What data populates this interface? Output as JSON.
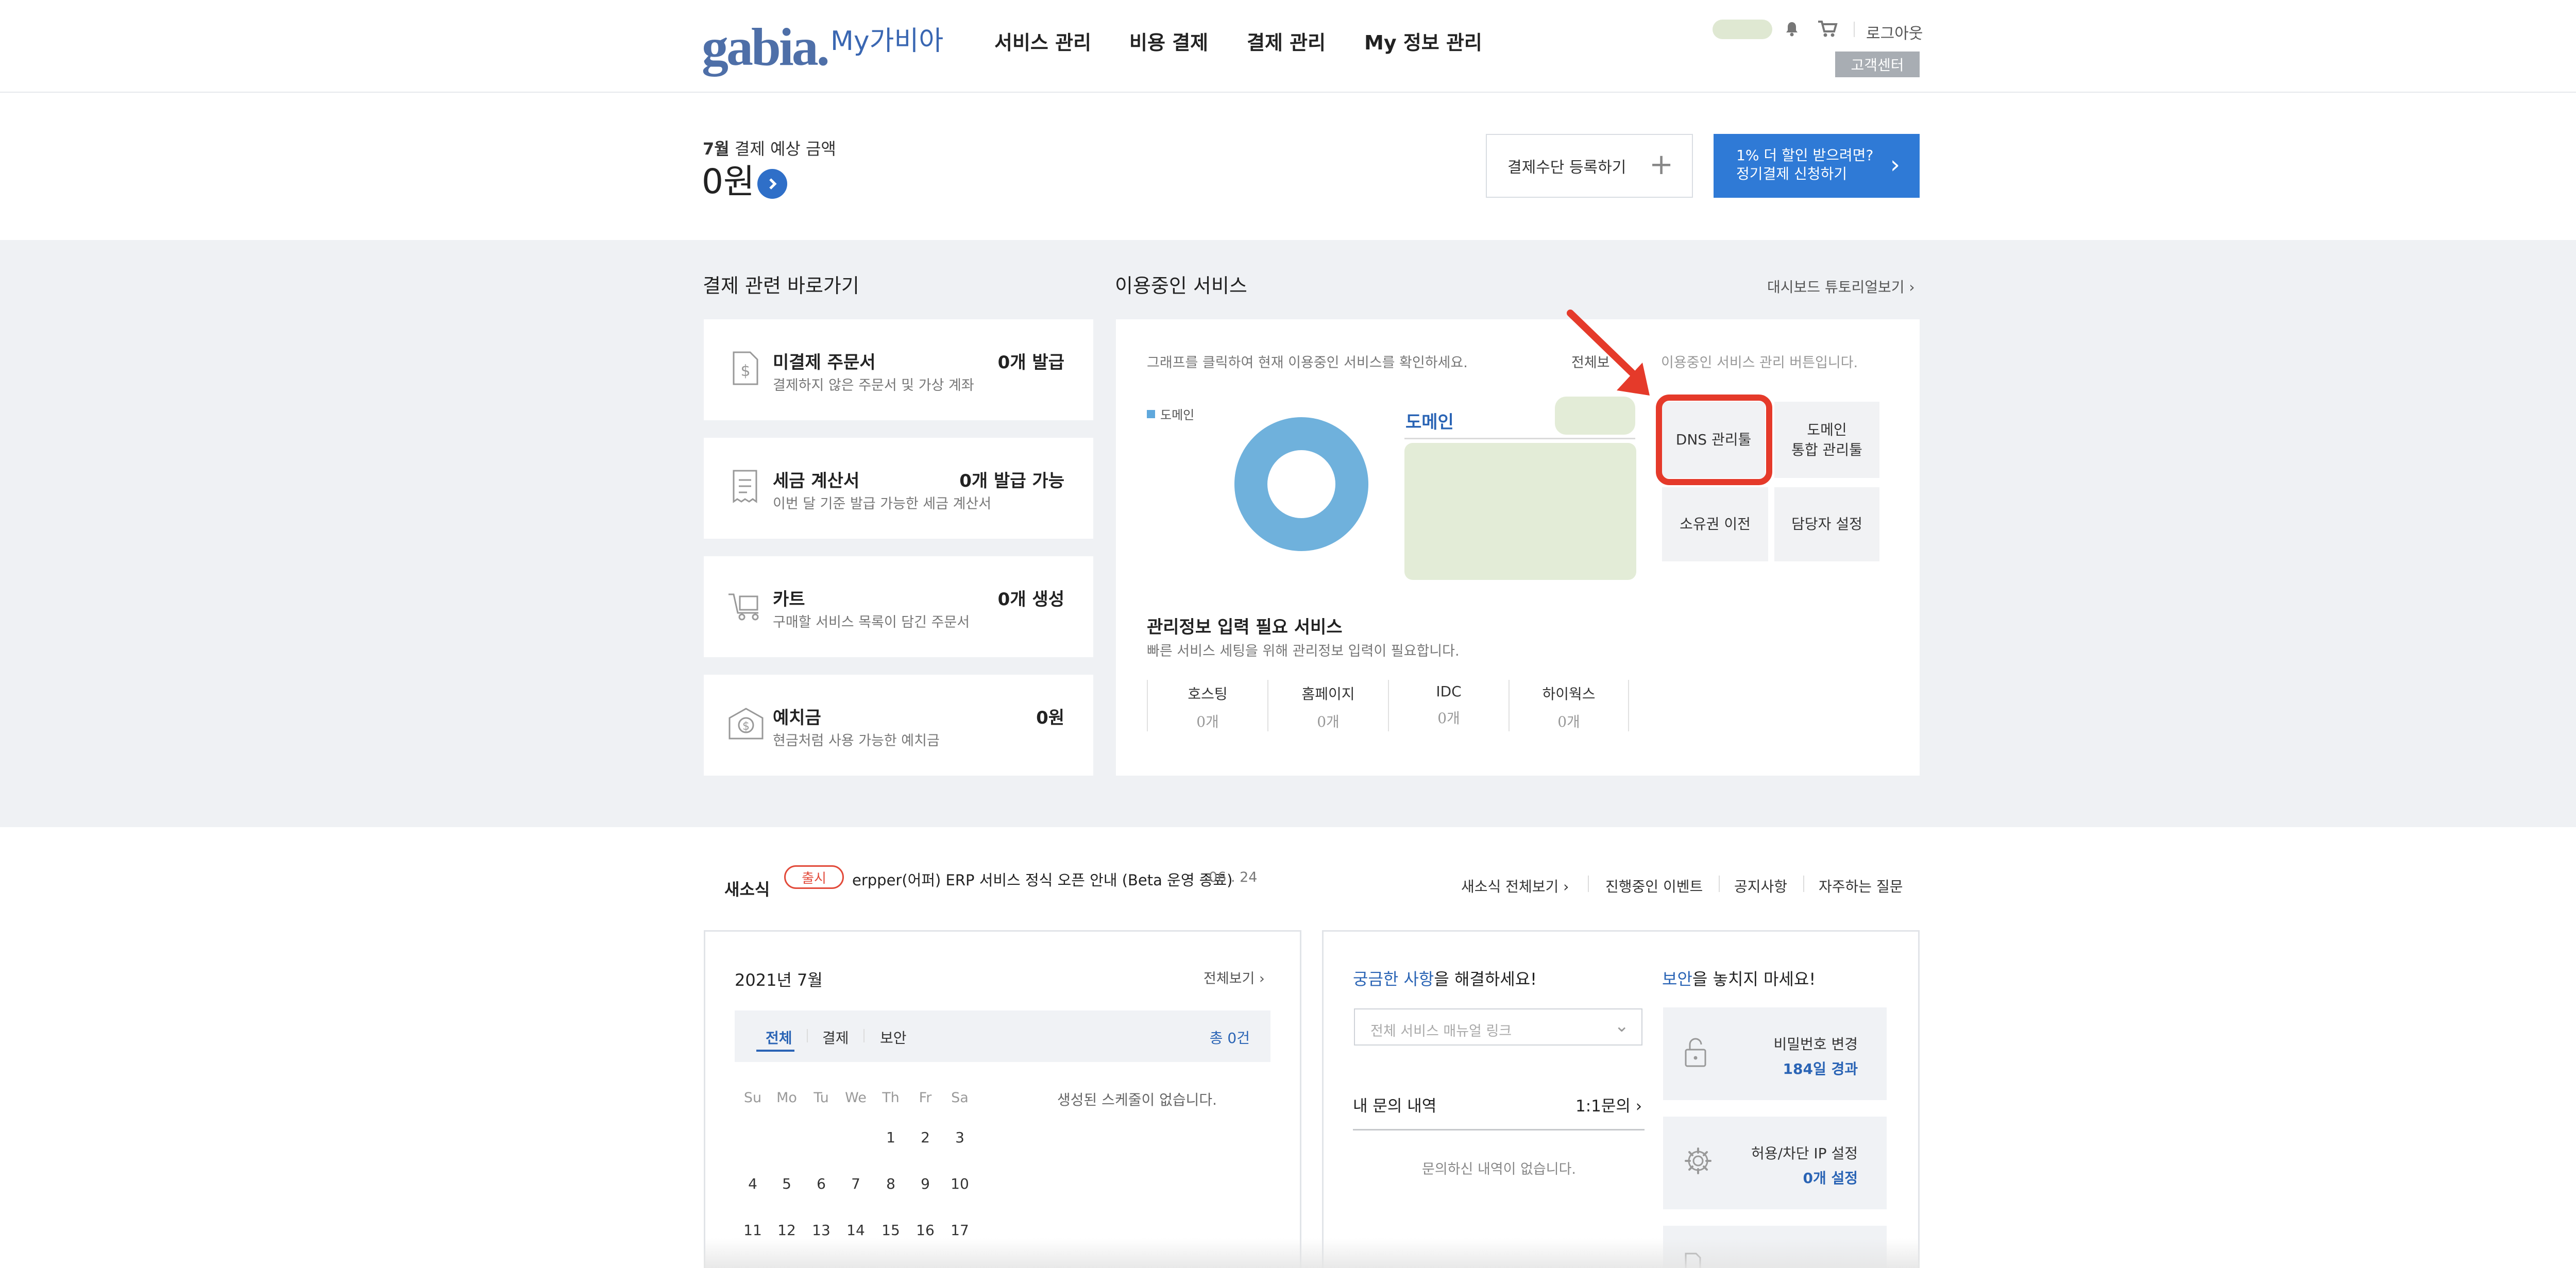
{
  "header": {
    "logo_text": "gabia.",
    "logo_sub": "My가비아",
    "nav": [
      "서비스 관리",
      "비용 결제",
      "결제 관리",
      "My 정보 관리"
    ],
    "logout": "로그아웃",
    "customer_center": "고객센터"
  },
  "billing": {
    "month": "7월",
    "label": "결제 예상 금액",
    "amount": "0원",
    "register_button": "결제수단 등록하기",
    "promo_line1": "1% 더 할인 받으려면?",
    "promo_line2": "정기결제 신청하기"
  },
  "shortcuts": {
    "title": "결제 관련 바로가기",
    "items": [
      {
        "title": "미결제 주문서",
        "desc": "결제하지 않은 주문서 및 가상 계좌",
        "value": "0개 발급",
        "icon": "invoice-dollar-icon"
      },
      {
        "title": "세금 계산서",
        "desc": "이번 달 기준 발급 가능한 세금 계산서",
        "value": "0개 발급 가능",
        "icon": "receipt-icon"
      },
      {
        "title": "카트",
        "desc": "구매할 서비스 목록이 담긴 주문서",
        "value": "0개 생성",
        "icon": "cart-icon"
      },
      {
        "title": "예치금",
        "desc": "현금처럼 사용 가능한 예치금",
        "value": "0원",
        "icon": "deposit-icon"
      }
    ]
  },
  "services": {
    "title": "이용중인 서비스",
    "tutorial": "대시보드 튜토리얼보기",
    "instruction": "그래프를 클릭하여 현재 이용중인 서비스를 확인하세요.",
    "all_view": "전체보",
    "manage_hint": "이용중인 서비스 관리 버튼입니다.",
    "legend": "도메인",
    "domain_label": "도메인",
    "buttons": {
      "dns": "DNS 관리툴",
      "domain_line1": "도메인",
      "domain_line2": "통합 관리툴",
      "transfer": "소유권 이전",
      "contact": "담당자 설정"
    },
    "needs_input_title": "관리정보 입력 필요 서비스",
    "needs_input_desc": "빠른 서비스 세팅을 위해 관리정보 입력이 필요합니다.",
    "needs_input": [
      {
        "name": "호스팅",
        "count": "0개"
      },
      {
        "name": "홈페이지",
        "count": "0개"
      },
      {
        "name": "IDC",
        "count": "0개"
      },
      {
        "name": "하이웍스",
        "count": "0개"
      }
    ]
  },
  "news": {
    "label": "새소식",
    "badge": "출시",
    "headline": "erpper(어퍼) ERP 서비스 정식 오픈 안내 (Beta 운영 종료)",
    "date": "06 . 24",
    "links": [
      "새소식 전체보기",
      "진행중인 이벤트",
      "공지사항",
      "자주하는 질문"
    ]
  },
  "calendar": {
    "title": "2021년 7월",
    "all_view": "전체보기",
    "tabs": [
      "전체",
      "결제",
      "보안"
    ],
    "total": "총 0건",
    "weekdays": [
      "Su",
      "Mo",
      "Tu",
      "We",
      "Th",
      "Fr",
      "Sa"
    ],
    "week1": [
      "1",
      "2",
      "3"
    ],
    "week2": [
      "4",
      "5",
      "6",
      "7",
      "8",
      "9",
      "10"
    ],
    "week3": [
      "11",
      "12",
      "13",
      "14",
      "15",
      "16",
      "17"
    ],
    "empty": "생성된 스케줄이 없습니다."
  },
  "help": {
    "title_hl": "궁금한 사항",
    "title_rest": "을 해결하세요!",
    "select_placeholder": "전체 서비스 매뉴얼 링크",
    "inquiry_title": "내 문의 내역",
    "inquiry_link": "1:1문의",
    "inquiry_empty": "문의하신 내역이 없습니다."
  },
  "security": {
    "title_hl": "보안",
    "title_rest": "을 놓치지 마세요!",
    "items": [
      {
        "label": "비밀번호 변경",
        "value": "184일 경과"
      },
      {
        "label": "허용/차단 IP 설정",
        "value": "0개 설정"
      }
    ]
  },
  "colors": {
    "brand_blue": "#2f7ad6",
    "donut": "#6fb1dc",
    "highlight_red": "#e53a2a",
    "pale_green": "#e3ecd7"
  }
}
